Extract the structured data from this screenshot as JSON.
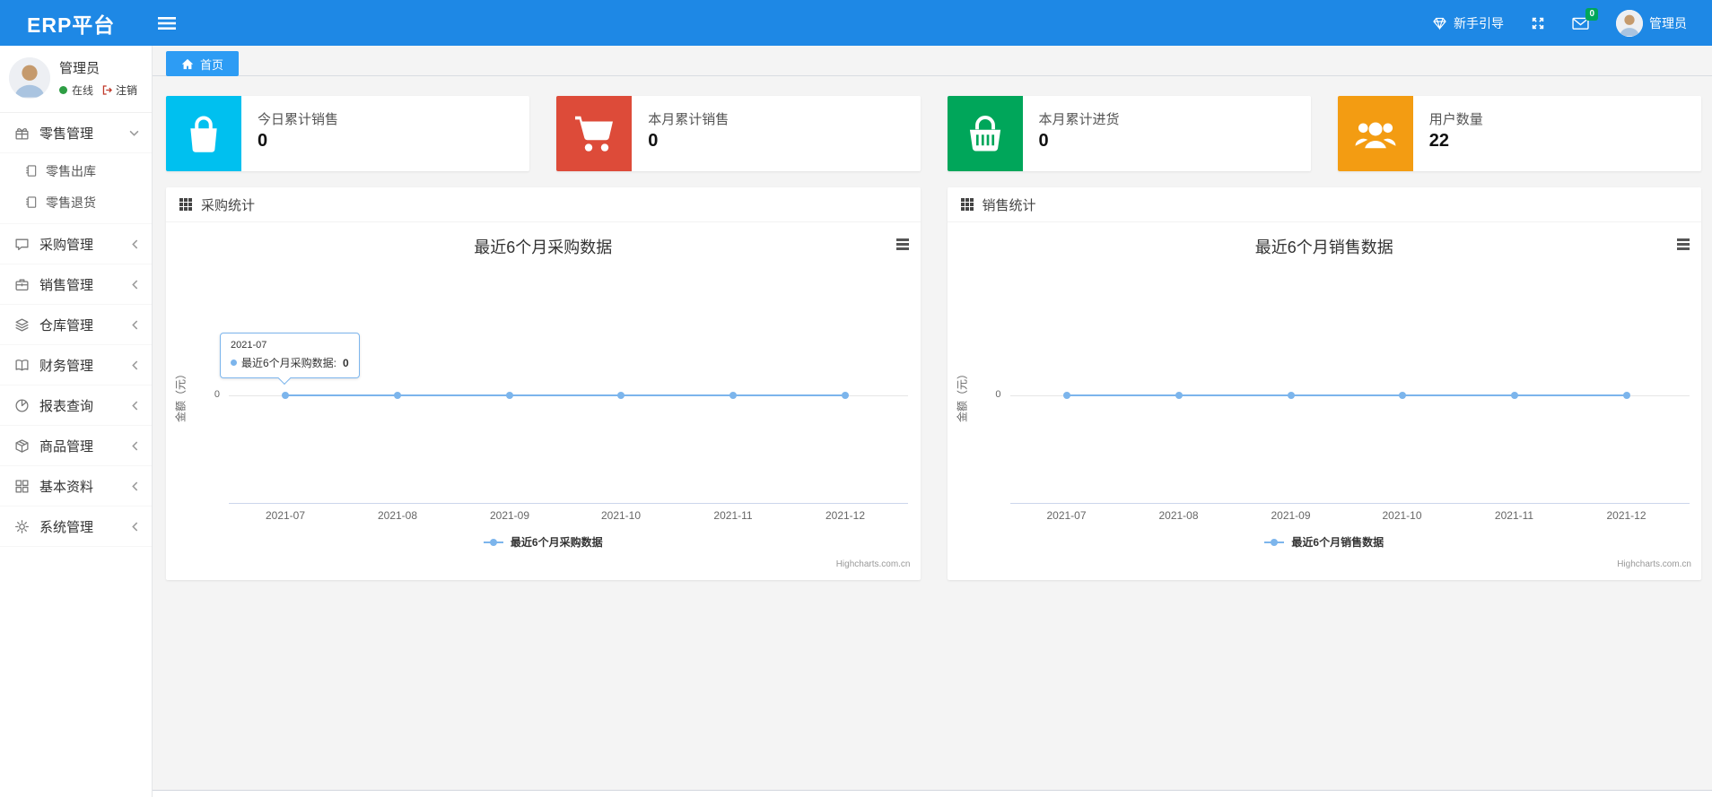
{
  "navbar": {
    "brand": "ERP平台",
    "guide_label": "新手引导",
    "message_badge": "0",
    "user_name": "管理员"
  },
  "sidebar": {
    "user": {
      "name": "管理员",
      "status_online": "在线",
      "logout_label": "注销"
    },
    "items": [
      {
        "label": "零售管理",
        "icon": "gift-icon",
        "expanded": true,
        "children": [
          {
            "label": "零售出库",
            "icon": "journal-icon"
          },
          {
            "label": "零售退货",
            "icon": "journal-icon"
          }
        ]
      },
      {
        "label": "采购管理",
        "icon": "comment-icon",
        "expanded": false
      },
      {
        "label": "销售管理",
        "icon": "briefcase-icon",
        "expanded": false
      },
      {
        "label": "仓库管理",
        "icon": "layers-icon",
        "expanded": false
      },
      {
        "label": "财务管理",
        "icon": "open-book-icon",
        "expanded": false
      },
      {
        "label": "报表查询",
        "icon": "pie-chart-icon",
        "expanded": false
      },
      {
        "label": "商品管理",
        "icon": "package-icon",
        "expanded": false
      },
      {
        "label": "基本资料",
        "icon": "grid-icon",
        "expanded": false
      },
      {
        "label": "系统管理",
        "icon": "gear-icon",
        "expanded": false
      }
    ]
  },
  "breadcrumb": {
    "home_label": "首页"
  },
  "stat_cards": [
    {
      "label": "今日累计销售",
      "value": "0",
      "color": "#00c0ef",
      "icon": "shopping-bag-icon"
    },
    {
      "label": "本月累计销售",
      "value": "0",
      "color": "#dd4b39",
      "icon": "shopping-cart-icon"
    },
    {
      "label": "本月累计进货",
      "value": "0",
      "color": "#00a65a",
      "icon": "shopping-basket-icon"
    },
    {
      "label": "用户数量",
      "value": "22",
      "color": "#f39c12",
      "icon": "users-icon"
    }
  ],
  "chart_data": [
    {
      "type": "line",
      "panel_title": "采购统计",
      "title": "最近6个月采购数据",
      "categories": [
        "2021-07",
        "2021-08",
        "2021-09",
        "2021-10",
        "2021-11",
        "2021-12"
      ],
      "series": [
        {
          "name": "最近6个月采购数据",
          "values": [
            0,
            0,
            0,
            0,
            0,
            0
          ]
        }
      ],
      "ylabel": "金额（元）",
      "yticks": [
        "0"
      ],
      "line_color": "#7cb5ec",
      "legend_position": "bottom",
      "credits": "Highcharts.com.cn",
      "tooltip": {
        "category": "2021-07",
        "series": "最近6个月采购数据",
        "value": "0"
      }
    },
    {
      "type": "line",
      "panel_title": "销售统计",
      "title": "最近6个月销售数据",
      "categories": [
        "2021-07",
        "2021-08",
        "2021-09",
        "2021-10",
        "2021-11",
        "2021-12"
      ],
      "series": [
        {
          "name": "最近6个月销售数据",
          "values": [
            0,
            0,
            0,
            0,
            0,
            0
          ]
        }
      ],
      "ylabel": "金额（元）",
      "yticks": [
        "0"
      ],
      "line_color": "#7cb5ec",
      "legend_position": "bottom",
      "credits": "Highcharts.com.cn",
      "tooltip": null
    }
  ],
  "colors": {
    "navbar": "#1e88e5",
    "breadcrumb_tab": "#2d9cf4",
    "chart_line": "#7cb5ec",
    "badge_green": "#00a65a",
    "online_dot": "#2e9e44"
  }
}
